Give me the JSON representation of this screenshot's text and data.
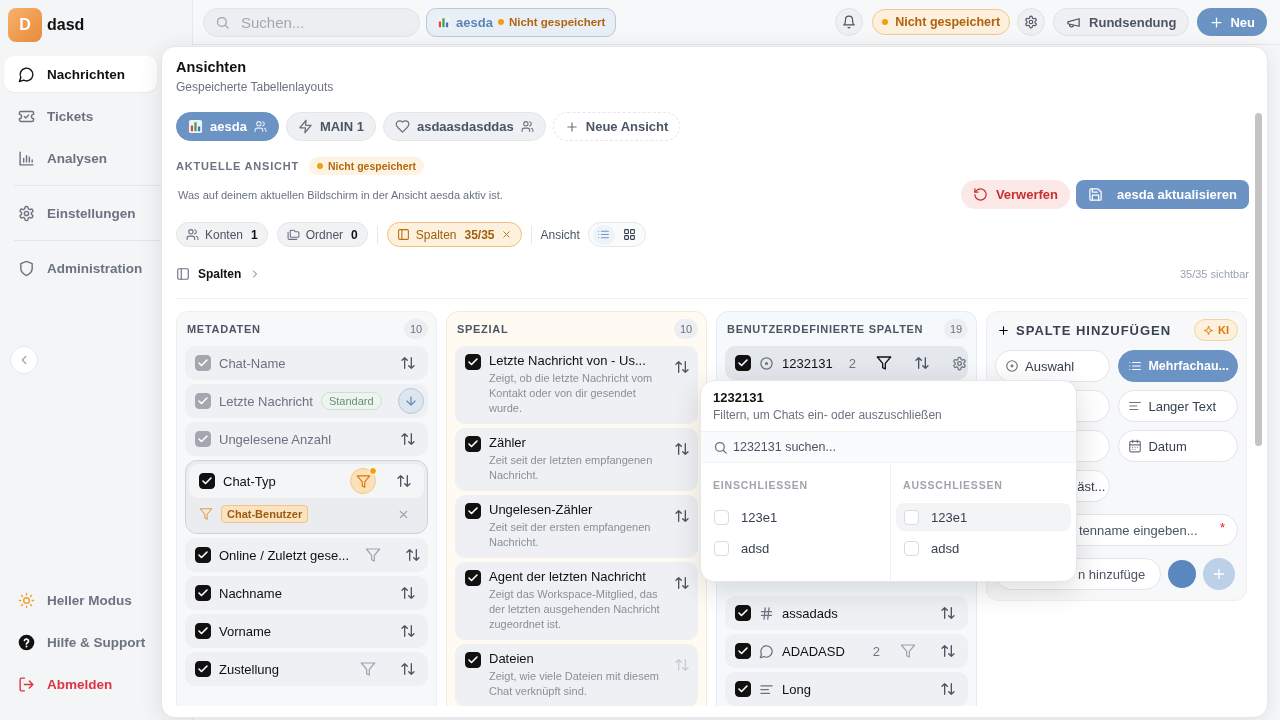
{
  "app": {
    "logo": "D",
    "name": "dasd"
  },
  "sidebar": {
    "items": [
      {
        "label": "Nachrichten",
        "selected": true
      },
      {
        "label": "Tickets",
        "selected": false
      },
      {
        "label": "Analysen",
        "selected": false
      },
      {
        "label": "Einstellungen",
        "selected": false
      },
      {
        "label": "Administration",
        "selected": false
      }
    ],
    "footer": [
      {
        "label": "Heller Modus",
        "kind": "theme"
      },
      {
        "label": "Hilfe & Support",
        "kind": "help"
      },
      {
        "label": "Abmelden",
        "kind": "logout"
      }
    ]
  },
  "topbar": {
    "search": {
      "placeholder": "Suchen..."
    },
    "view_chip": {
      "label": "aesda",
      "status": "Nicht gespeichert"
    },
    "status_badge": "Nicht gespeichert",
    "broadcast_button": "Rundsendung",
    "new_button": "Neu"
  },
  "views": {
    "title": "Ansichten",
    "subtitle": "Gespeicherte Tabellenlayouts",
    "tabs": [
      {
        "label": "aesda",
        "selected": true,
        "shared": true
      },
      {
        "label": "MAIN 1",
        "selected": false,
        "shared": false
      },
      {
        "label": "asdaasdasddas",
        "selected": false,
        "shared": true
      }
    ],
    "new_view": "Neue Ansicht"
  },
  "current_view": {
    "heading": "AKTUELLE ANSICHT",
    "badge": "Nicht gespeichert",
    "description": "Was auf deinem aktuellen Bildschirm in der Ansicht aesda aktiv ist.",
    "discard_button": "Verwerfen",
    "update_button": "aesda aktualisieren",
    "chips": [
      {
        "label": "Konten",
        "count": "1",
        "active": false
      },
      {
        "label": "Ordner",
        "count": "0",
        "active": false
      },
      {
        "label": "Spalten",
        "count": "35/35",
        "active": true
      }
    ],
    "display_label": "Ansicht",
    "display_modes": [
      {
        "selected": true
      },
      {
        "selected": false
      }
    ],
    "breadcrumb": "Spalten",
    "visible_count": "35/35 sichtbar"
  },
  "column_groups": [
    {
      "title": "METADATEN",
      "count": "10",
      "kind": "metadata",
      "items": [
        {
          "label": "Chat-Name",
          "checked": true,
          "locked": true,
          "expanded": false,
          "filterable": false,
          "filter_active": false,
          "sort_descending": false
        },
        {
          "label": "Letzte Nachricht",
          "checked": true,
          "locked": true,
          "expanded": false,
          "badge": "Standard",
          "filterable": false,
          "filter_active": false,
          "sort_descending": true
        },
        {
          "label": "Ungelesene Anzahl",
          "checked": true,
          "locked": true,
          "expanded": false,
          "filterable": false,
          "filter_active": false,
          "sort_descending": false
        },
        {
          "label": "Chat-Typ",
          "checked": true,
          "locked": false,
          "expanded": true,
          "filterable": true,
          "filter_active": true,
          "sort_descending": false,
          "filter_tags": [
            "Chat-Benutzer"
          ]
        },
        {
          "label": "Online / Zuletzt gese...",
          "checked": true,
          "locked": false,
          "expanded": false,
          "filterable": true,
          "filter_active": false,
          "sort_descending": false
        },
        {
          "label": "Nachname",
          "checked": true,
          "locked": false,
          "expanded": false,
          "filterable": false,
          "filter_active": false,
          "sort_descending": false
        },
        {
          "label": "Vorname",
          "checked": true,
          "locked": false,
          "expanded": false,
          "filterable": false,
          "filter_active": false,
          "sort_descending": false
        },
        {
          "label": "Zustellung",
          "checked": true,
          "locked": false,
          "expanded": false,
          "filterable": true,
          "filter_active": false,
          "sort_descending": false
        }
      ]
    },
    {
      "title": "SPEZIAL",
      "count": "10",
      "kind": "special",
      "items": [
        {
          "label": "Letzte Nachricht von - Us...",
          "description": "Zeigt, ob die letzte Nachricht vom Kontakt oder von dir gesendet wurde.",
          "checked": true,
          "sortable": true
        },
        {
          "label": "Zähler",
          "description": "Zeit seit der letzten empfangenen Nachricht.",
          "checked": true,
          "sortable": true
        },
        {
          "label": "Ungelesen-Zähler",
          "description": "Zeit seit der ersten empfangenen Nachricht.",
          "checked": true,
          "sortable": true
        },
        {
          "label": "Agent der letzten Nachricht",
          "description": "Zeigt das Workspace-Mitglied, das der letzten ausgehenden Nachricht zugeordnet ist.",
          "checked": true,
          "sortable": true
        },
        {
          "label": "Dateien",
          "description": "Zeigt, wie viele Dateien mit diesem Chat verknüpft sind.",
          "checked": true,
          "sortable": false
        }
      ]
    },
    {
      "title": "BENUTZERDEFINIERTE SPALTEN",
      "count": "19",
      "kind": "custom",
      "items": [
        {
          "label": "1232131",
          "kind": "select",
          "count": "2",
          "checked": true,
          "active": true,
          "filterable": true,
          "filter_active": true
        },
        {
          "label": "assadads",
          "kind": "number",
          "checked": true,
          "active": false,
          "filterable": false,
          "filter_active": false
        },
        {
          "label": "ADADASD",
          "kind": "comment",
          "count": "2",
          "checked": true,
          "active": false,
          "filterable": true,
          "filter_active": false
        },
        {
          "label": "Long",
          "kind": "longtext",
          "checked": true,
          "active": false,
          "filterable": false,
          "filter_active": false
        }
      ]
    }
  ],
  "add_column": {
    "title": "SPALTE HINZUFÜGEN",
    "ai_badge": "KI",
    "types": [
      {
        "label": "Auswahl",
        "selected": false
      },
      {
        "label": "Mehrfachau...",
        "selected": true
      },
      {
        "selected": false
      },
      {
        "label": "Langer Text",
        "selected": false
      },
      {
        "selected": false
      },
      {
        "label": "Datum",
        "selected": false
      },
      {
        "label": "äst...",
        "selected": false
      }
    ],
    "name_field": {
      "placeholder": "tenname eingeben...",
      "required_mark": "*"
    },
    "option_field": {
      "placeholder": "n hinzufüge"
    },
    "add_disabled": true
  },
  "filter_popover": {
    "title": "1232131",
    "subtitle": "Filtern, um Chats ein- oder auszuschließen",
    "search_placeholder": "1232131 suchen...",
    "sections": [
      {
        "heading": "EINSCHLIESSEN",
        "options": [
          {
            "label": "123e1",
            "checked": false,
            "highlighted": false
          },
          {
            "label": "adsd",
            "checked": false,
            "highlighted": false
          }
        ]
      },
      {
        "heading": "AUSSCHLIESSEN",
        "options": [
          {
            "label": "123e1",
            "checked": false,
            "highlighted": true
          },
          {
            "label": "adsd",
            "checked": false,
            "highlighted": false
          }
        ]
      }
    ]
  }
}
